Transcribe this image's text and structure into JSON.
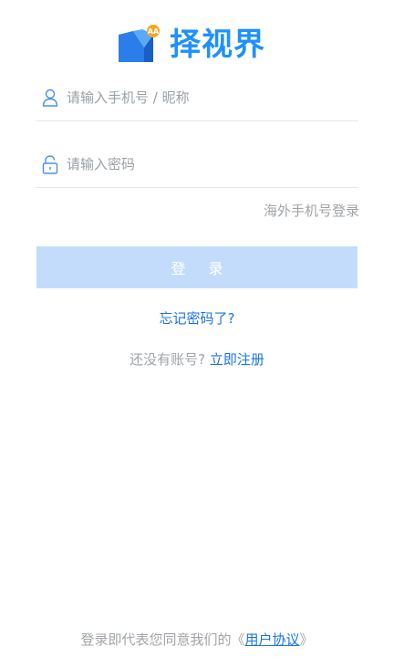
{
  "brand": {
    "name": "择视界",
    "badge": "AA",
    "primary_color": "#1e90ff",
    "badge_color": "#f5a623"
  },
  "form": {
    "phone": {
      "placeholder": "请输入手机号 / 昵称",
      "value": "",
      "icon": "user-icon"
    },
    "password": {
      "placeholder": "请输入密码",
      "value": "",
      "icon": "lock-icon"
    },
    "overseas_login": "海外手机号登录",
    "login_button": "登 录",
    "login_button_color": "#c3dcfb"
  },
  "links": {
    "forgot_password": "忘记密码了?",
    "no_account": "还没有账号?",
    "register": "立即注册"
  },
  "footer": {
    "agreement_prefix": "登录即代表您同意我们的《",
    "agreement_link": "用户协议",
    "agreement_suffix": "》"
  }
}
